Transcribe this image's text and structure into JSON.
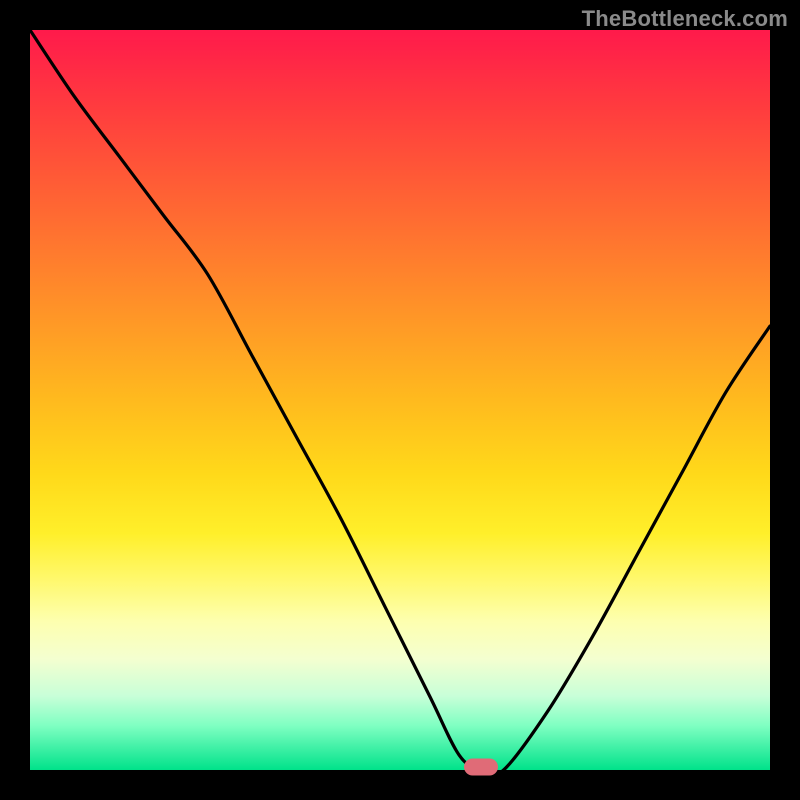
{
  "watermark": "TheBottleneck.com",
  "chart_data": {
    "type": "line",
    "title": "",
    "xlabel": "",
    "ylabel": "",
    "xlim": [
      0,
      100
    ],
    "ylim": [
      0,
      100
    ],
    "optimum_x": 61,
    "series": [
      {
        "name": "bottleneck-curve",
        "x": [
          0,
          6,
          12,
          18,
          24,
          30,
          36,
          42,
          48,
          54,
          58,
          61,
          64,
          70,
          76,
          82,
          88,
          94,
          100
        ],
        "values": [
          100,
          91,
          83,
          75,
          67,
          56,
          45,
          34,
          22,
          10,
          2,
          0,
          0,
          8,
          18,
          29,
          40,
          51,
          60
        ]
      }
    ],
    "marker": {
      "x": 61,
      "y": 0,
      "color": "#e06b77"
    },
    "gradient_stops": [
      {
        "pos": 0.0,
        "color": "#ff1a4b"
      },
      {
        "pos": 0.5,
        "color": "#ffba1e"
      },
      {
        "pos": 0.8,
        "color": "#fdffb0"
      },
      {
        "pos": 1.0,
        "color": "#00e28a"
      }
    ]
  }
}
